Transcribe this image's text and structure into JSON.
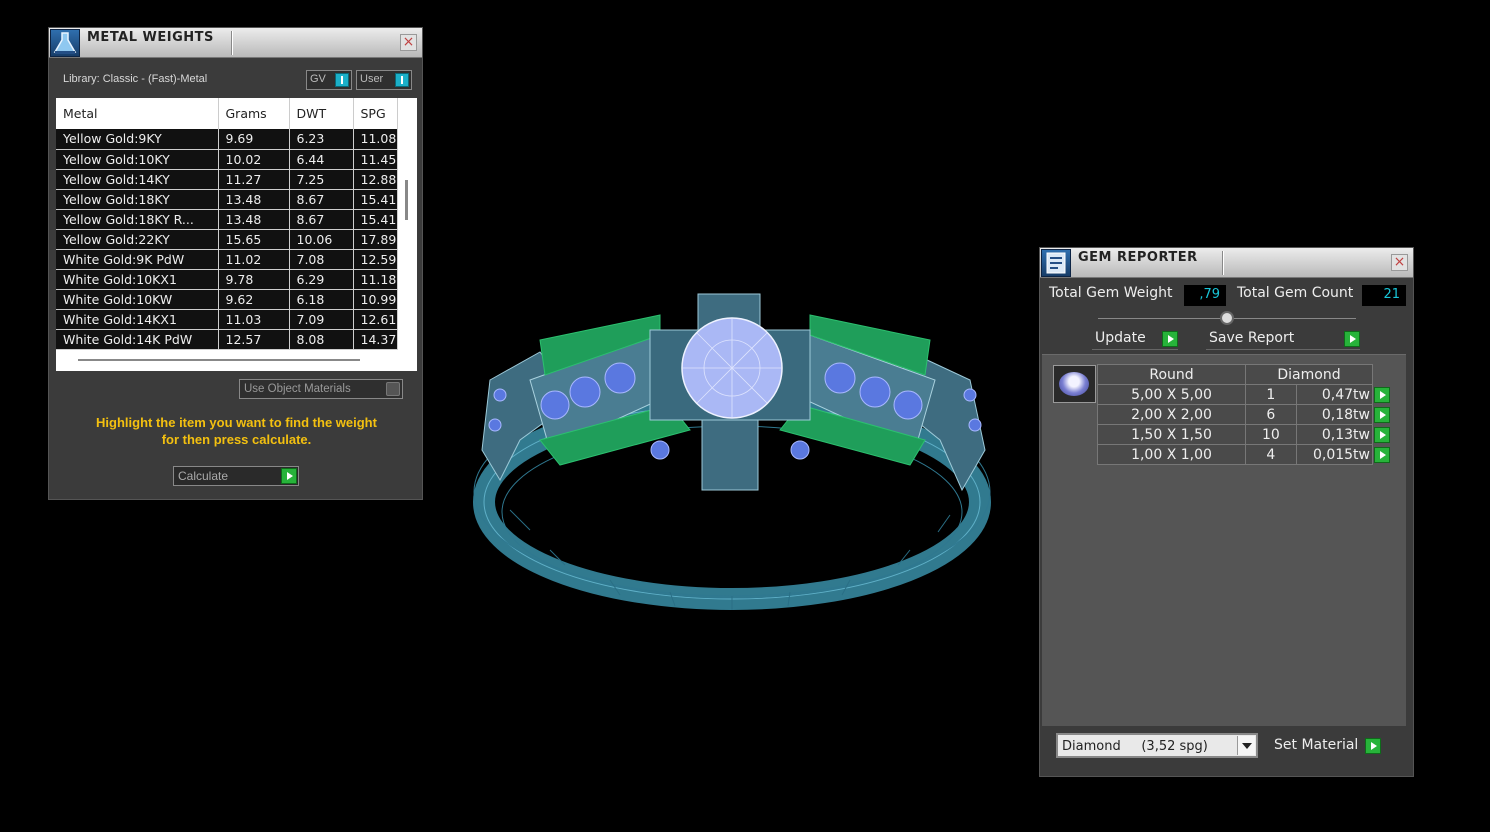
{
  "metal_weights": {
    "title": "METAL WEIGHTS",
    "close": "×",
    "library_label": "Library: Classic - (Fast)-Metal",
    "toggle_gv": "GV",
    "toggle_user": "User",
    "columns": [
      "Metal",
      "Grams",
      "DWT",
      "SPG"
    ],
    "rows": [
      [
        "Yellow Gold:9KY",
        "9.69",
        "6.23",
        "11.08"
      ],
      [
        "Yellow Gold:10KY",
        "10.02",
        "6.44",
        "11.45"
      ],
      [
        "Yellow Gold:14KY",
        "11.27",
        "7.25",
        "12.88"
      ],
      [
        "Yellow Gold:18KY",
        "13.48",
        "8.67",
        "15.41"
      ],
      [
        "Yellow Gold:18KY R...",
        "13.48",
        "8.67",
        "15.41"
      ],
      [
        "Yellow Gold:22KY",
        "15.65",
        "10.06",
        "17.89"
      ],
      [
        "White Gold:9K PdW",
        "11.02",
        "7.08",
        "12.59"
      ],
      [
        "White Gold:10KX1",
        "9.78",
        "6.29",
        "11.18"
      ],
      [
        "White Gold:10KW",
        "9.62",
        "6.18",
        "10.99"
      ],
      [
        "White Gold:14KX1",
        "11.03",
        "7.09",
        "12.61"
      ],
      [
        "White Gold:14K PdW",
        "12.57",
        "8.08",
        "14.37"
      ]
    ],
    "use_object_materials": "Use Object Materials",
    "hint_line1": "Highlight the item you want to find the weight",
    "hint_line2": "for then press calculate.",
    "calculate_label": "Calculate"
  },
  "gem_reporter": {
    "title": "GEM REPORTER",
    "close": "×",
    "total_weight_label": "Total Gem Weight",
    "total_weight_value": ",79",
    "total_count_label": "Total Gem Count",
    "total_count_value": "21",
    "update_label": "Update",
    "save_report_label": "Save Report",
    "columns": [
      "Round",
      "Diamond"
    ],
    "rows": [
      [
        "5,00 X 5,00",
        "1",
        "0,47tw"
      ],
      [
        "2,00 X 2,00",
        "6",
        "0,18tw"
      ],
      [
        "1,50 X 1,50",
        "10",
        "0,13tw"
      ],
      [
        "1,00 X 1,00",
        "4",
        "0,015tw"
      ]
    ],
    "material_select": "Diamond     (3,52 spg)",
    "set_material_label": "Set Material"
  },
  "colors": {
    "accent_cyan": "#19c6d8",
    "button_green": "#27b33a",
    "hint_yellow": "#f3c010",
    "ring_wire": "#3a8fa8",
    "prong_green": "#1f9e5a",
    "gem_blue": "#5a78e0"
  }
}
